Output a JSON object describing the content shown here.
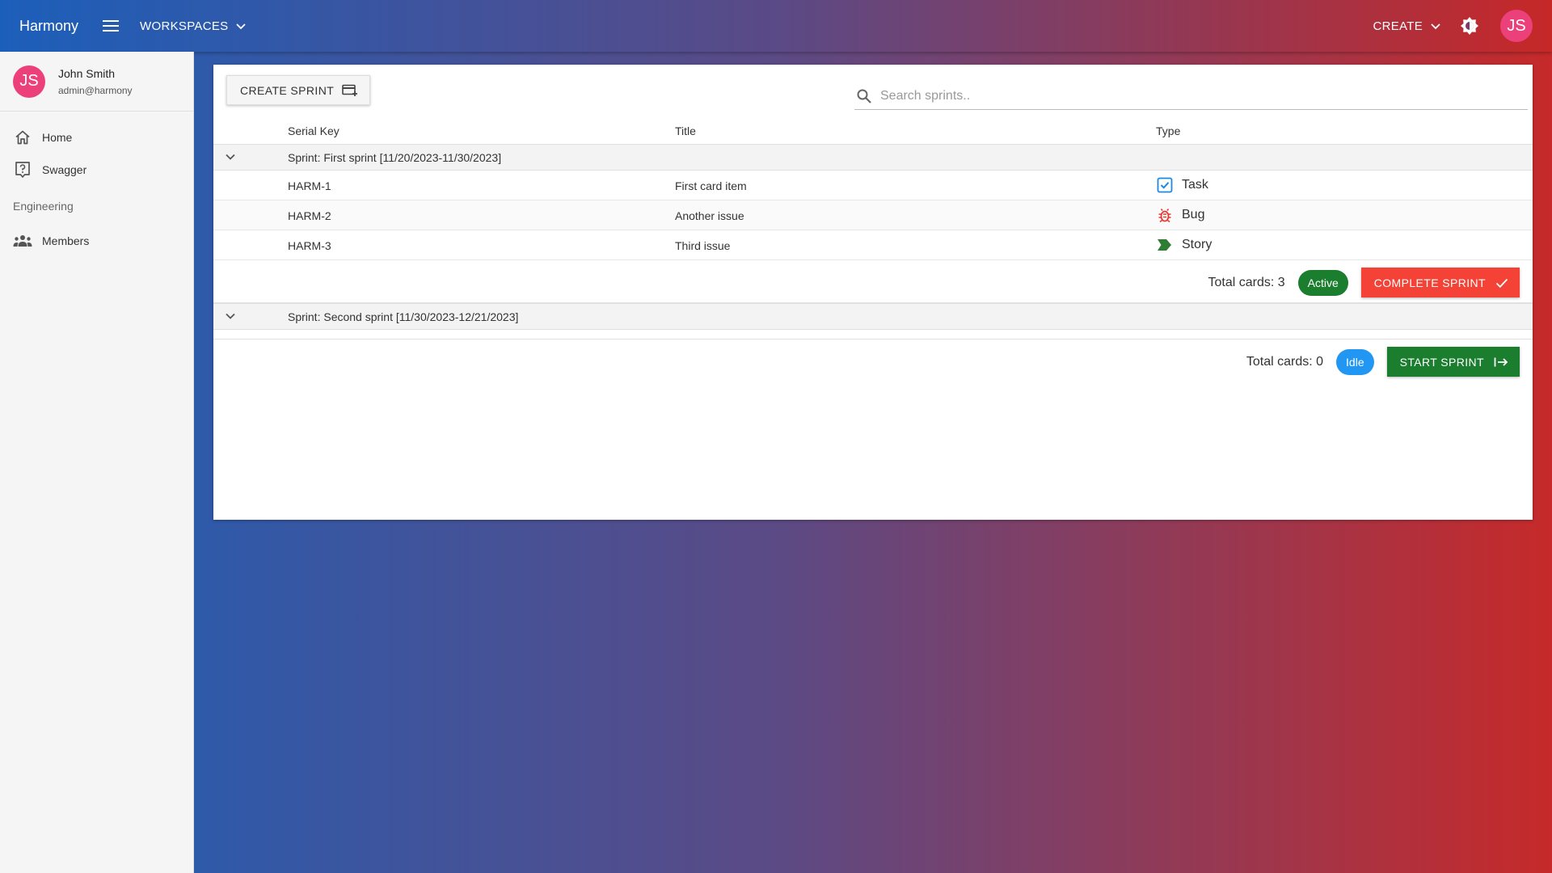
{
  "topbar": {
    "brand": "Harmony",
    "workspaces_label": "WORKSPACES",
    "create_label": "CREATE",
    "avatar_initials": "JS"
  },
  "sidebar": {
    "user": {
      "initials": "JS",
      "name": "John Smith",
      "email": "admin@harmony"
    },
    "items": [
      {
        "label": "Home",
        "icon": "home-icon"
      },
      {
        "label": "Swagger",
        "icon": "help-icon"
      }
    ],
    "section_label": "Engineering",
    "section_items": [
      {
        "label": "Members",
        "icon": "members-icon"
      }
    ]
  },
  "toolbar": {
    "create_sprint_label": "CREATE SPRINT",
    "search_placeholder": "Search sprints.."
  },
  "table": {
    "columns": [
      "Serial Key",
      "Title",
      "Type"
    ]
  },
  "sprints": [
    {
      "label": "Sprint: First sprint [11/20/2023-11/30/2023]",
      "cards": [
        {
          "key": "HARM-1",
          "title": "First card item",
          "type": "Task"
        },
        {
          "key": "HARM-2",
          "title": "Another issue",
          "type": "Bug"
        },
        {
          "key": "HARM-3",
          "title": "Third issue",
          "type": "Story"
        }
      ],
      "total_label": "Total cards: 3",
      "status": "Active",
      "action_label": "COMPLETE SPRINT"
    },
    {
      "label": "Sprint: Second sprint [11/30/2023-12/21/2023]",
      "cards": [],
      "total_label": "Total cards: 0",
      "status": "Idle",
      "action_label": "START SPRINT"
    }
  ],
  "colors": {
    "avatar": "#ec407a",
    "active": "#1b7e2f",
    "idle": "#2196f3",
    "complete": "#f44336",
    "task": "#1e88e5",
    "bug": "#e53935",
    "story": "#2e7d32"
  }
}
